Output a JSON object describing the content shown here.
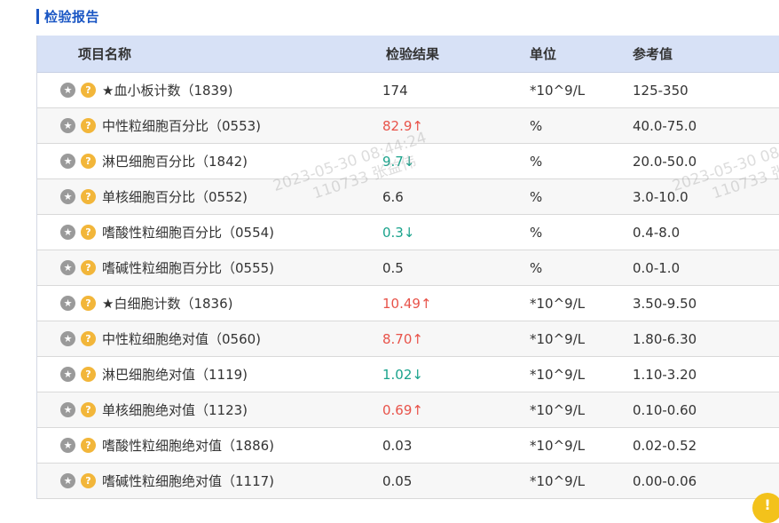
{
  "section": {
    "title": "检验报告"
  },
  "table": {
    "headers": {
      "name": "项目名称",
      "result": "检验结果",
      "unit": "单位",
      "ref": "参考值"
    },
    "rows": [
      {
        "name": "★血小板计数（1839)",
        "result": "174",
        "flag": "",
        "status": "normal",
        "unit": "*10^9/L",
        "ref": "125-350"
      },
      {
        "name": "中性粒细胞百分比（0553)",
        "result": "82.9",
        "flag": "↑",
        "status": "high",
        "unit": "%",
        "ref": "40.0-75.0"
      },
      {
        "name": "淋巴细胞百分比（1842)",
        "result": "9.7",
        "flag": "↓",
        "status": "low",
        "unit": "%",
        "ref": "20.0-50.0"
      },
      {
        "name": "单核细胞百分比（0552)",
        "result": "6.6",
        "flag": "",
        "status": "normal",
        "unit": "%",
        "ref": "3.0-10.0"
      },
      {
        "name": "嗜酸性粒细胞百分比（0554)",
        "result": "0.3",
        "flag": "↓",
        "status": "low",
        "unit": "%",
        "ref": "0.4-8.0"
      },
      {
        "name": "嗜碱性粒细胞百分比（0555)",
        "result": "0.5",
        "flag": "",
        "status": "normal",
        "unit": "%",
        "ref": "0.0-1.0"
      },
      {
        "name": "★白细胞计数（1836)",
        "result": "10.49",
        "flag": "↑",
        "status": "high",
        "unit": "*10^9/L",
        "ref": "3.50-9.50"
      },
      {
        "name": "中性粒细胞绝对值（0560)",
        "result": "8.70",
        "flag": "↑",
        "status": "high",
        "unit": "*10^9/L",
        "ref": "1.80-6.30"
      },
      {
        "name": "淋巴细胞绝对值（1119)",
        "result": "1.02",
        "flag": "↓",
        "status": "low",
        "unit": "*10^9/L",
        "ref": "1.10-3.20"
      },
      {
        "name": "单核细胞绝对值（1123)",
        "result": "0.69",
        "flag": "↑",
        "status": "high",
        "unit": "*10^9/L",
        "ref": "0.10-0.60"
      },
      {
        "name": "嗜酸性粒细胞绝对值（1886)",
        "result": "0.03",
        "flag": "",
        "status": "normal",
        "unit": "*10^9/L",
        "ref": "0.02-0.52"
      },
      {
        "name": "嗜碱性粒细胞绝对值（1117)",
        "result": "0.05",
        "flag": "",
        "status": "normal",
        "unit": "*10^9/L",
        "ref": "0.00-0.06"
      }
    ]
  },
  "icons": {
    "star": "star-icon",
    "question": "question-icon",
    "fab": "tip-icon"
  },
  "watermark": {
    "line1": "2023-05-30 08:44:24",
    "line2": "110733 张益伟"
  },
  "colors": {
    "accent": "#1a56c4",
    "header_bg": "#d7e1f6",
    "high": "#e8534a",
    "low": "#1aa38c"
  }
}
